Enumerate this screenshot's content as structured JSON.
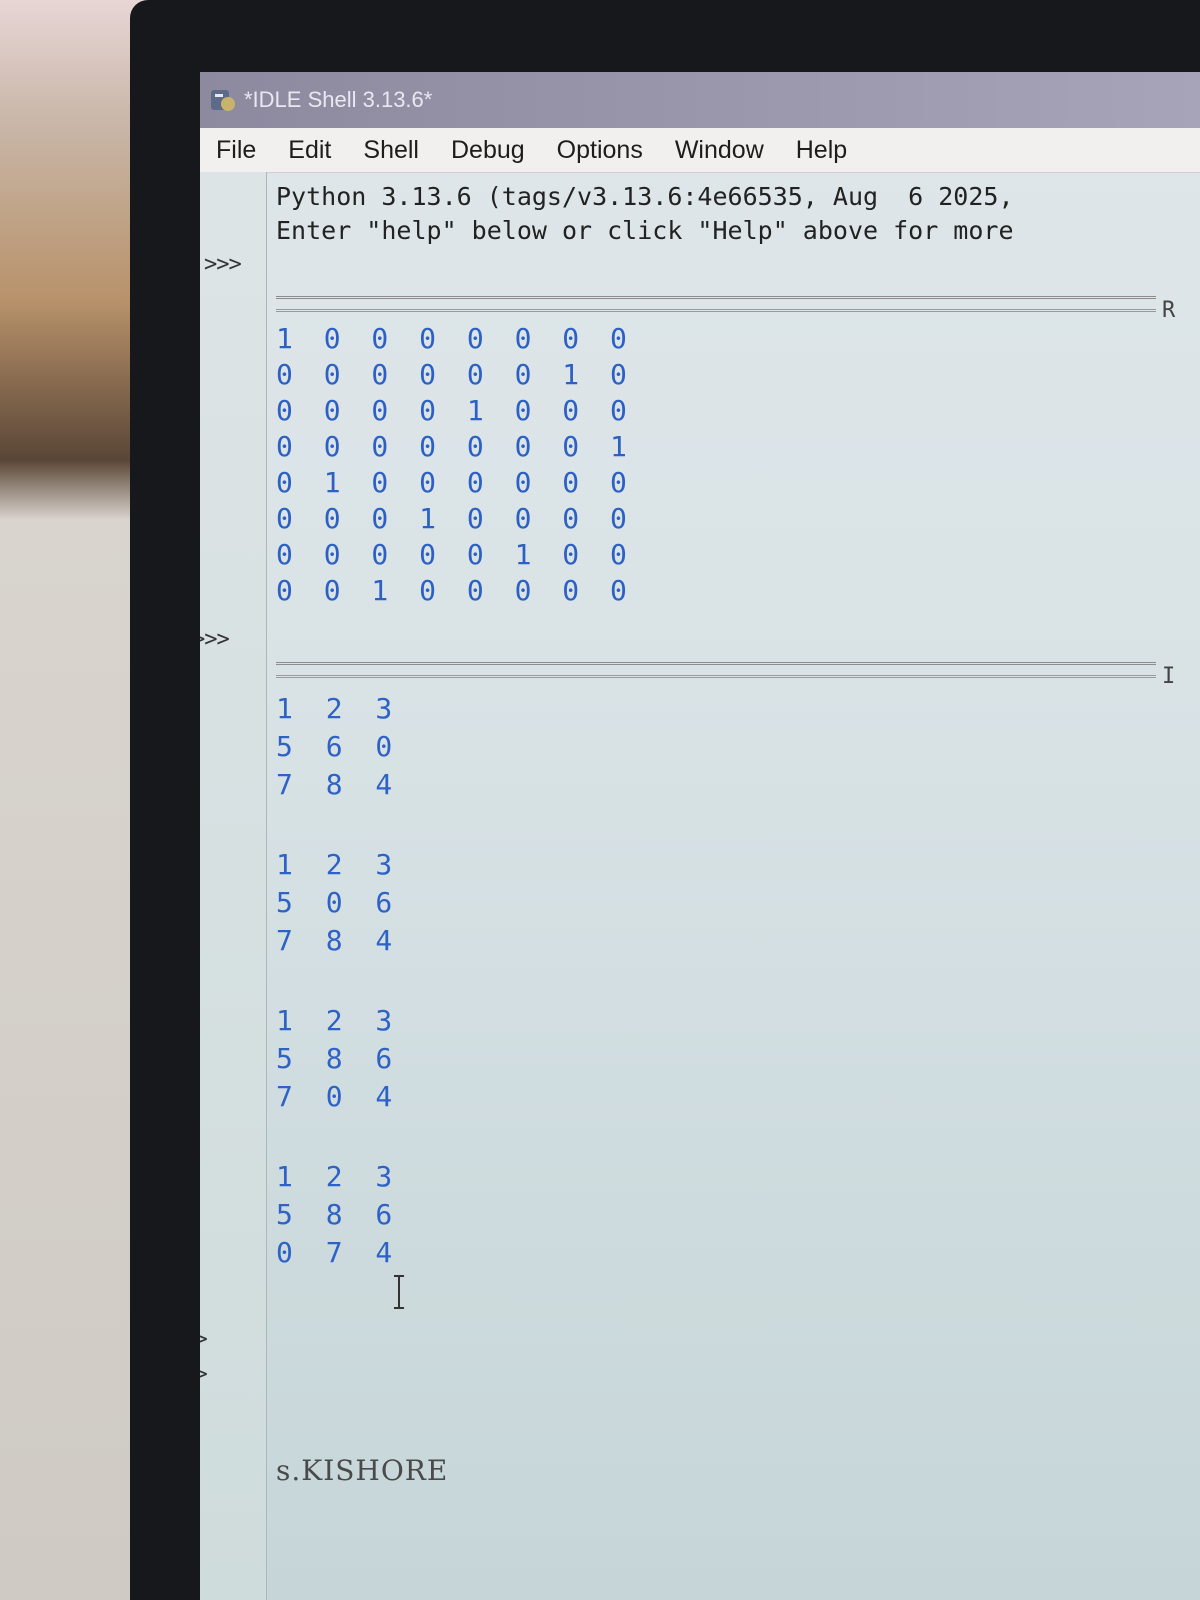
{
  "window": {
    "title": "*IDLE Shell 3.13.6*"
  },
  "menu": [
    "File",
    "Edit",
    "Shell",
    "Debug",
    "Options",
    "Window",
    "Help"
  ],
  "banner": {
    "line1": "Python 3.13.6 (tags/v3.13.6:4e66535, Aug  6 2025,",
    "line2": "Enter \"help\" below or click \"Help\" above for more"
  },
  "prompt_symbol": ">>>",
  "restart_tail": [
    "R",
    "I"
  ],
  "matrix_output": [
    "1 0 0 0 0 0 0 0",
    "0 0 0 0 0 0 1 0",
    "0 0 0 0 1 0 0 0",
    "0 0 0 0 0 0 0 1",
    "0 1 0 0 0 0 0 0",
    "0 0 0 1 0 0 0 0",
    "0 0 0 0 0 1 0 0",
    "0 0 1 0 0 0 0 0"
  ],
  "puzzle_states": [
    [
      "1 2 3",
      "5 6 0",
      "7 8 4"
    ],
    [
      "1 2 3",
      "5 0 6",
      "7 8 4"
    ],
    [
      "1 2 3",
      "5 8 6",
      "7 0 4"
    ],
    [
      "1 2 3",
      "5 8 6",
      "0 7 4"
    ]
  ],
  "last_input": "s.KISHORE"
}
